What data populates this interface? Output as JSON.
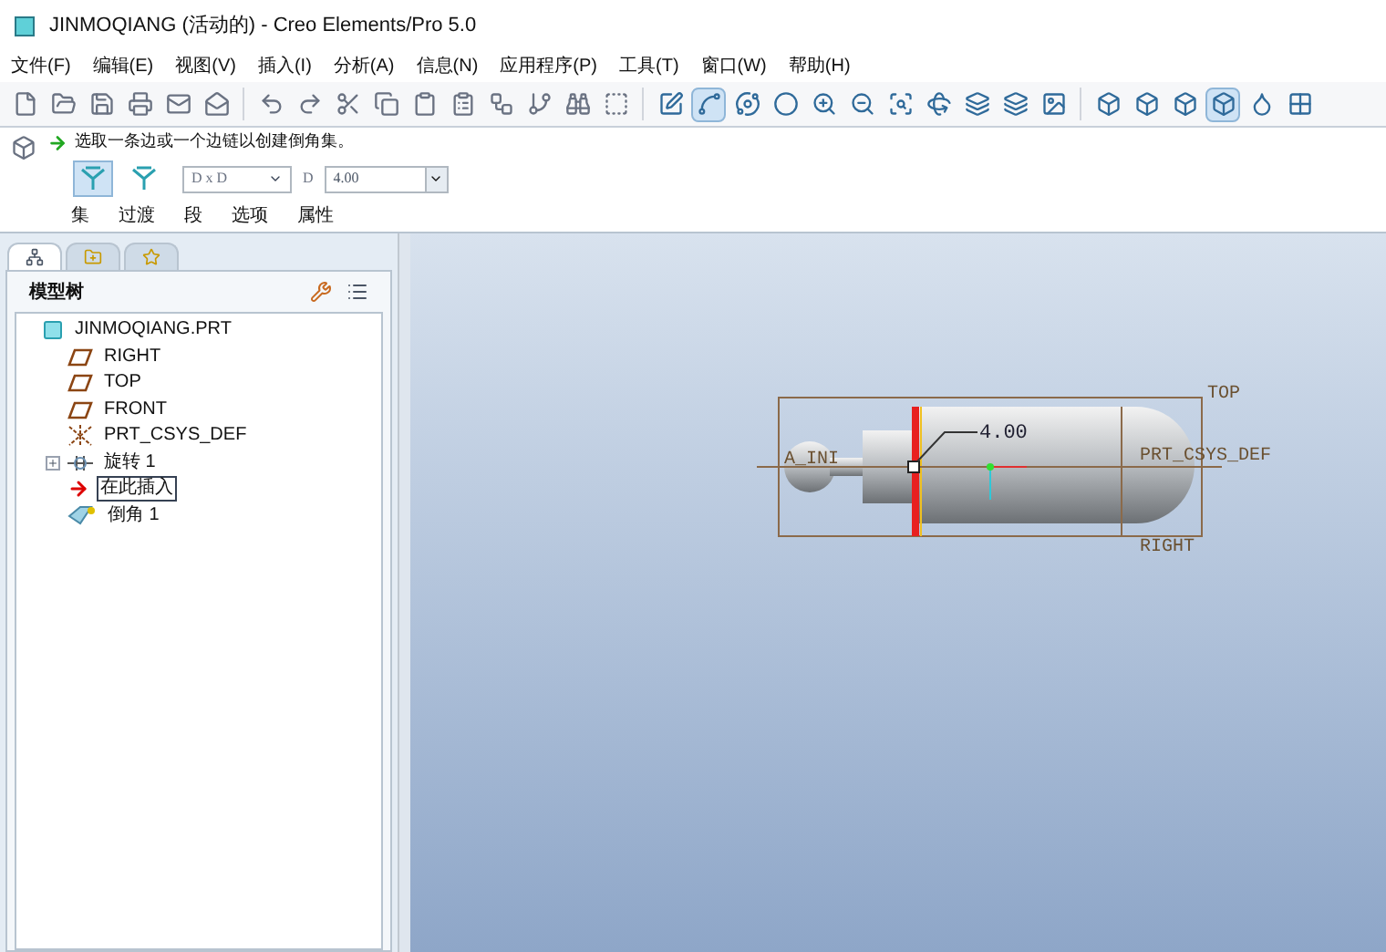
{
  "window": {
    "title": "JINMOQIANG (活动的) - Creo Elements/Pro 5.0"
  },
  "menu": [
    "文件(F)",
    "编辑(E)",
    "视图(V)",
    "插入(I)",
    "分析(A)",
    "信息(N)",
    "应用程序(P)",
    "工具(T)",
    "窗口(W)",
    "帮助(H)"
  ],
  "toolbar": [
    {
      "kind": "new"
    },
    {
      "kind": "open"
    },
    {
      "kind": "save"
    },
    {
      "kind": "print"
    },
    {
      "kind": "mail"
    },
    {
      "kind": "mail2"
    },
    {
      "kind": "sep"
    },
    {
      "kind": "undo"
    },
    {
      "kind": "redo"
    },
    {
      "kind": "cut"
    },
    {
      "kind": "copy"
    },
    {
      "kind": "paste"
    },
    {
      "kind": "paste2"
    },
    {
      "kind": "regen"
    },
    {
      "kind": "regen2"
    },
    {
      "kind": "find"
    },
    {
      "kind": "selbox"
    },
    {
      "kind": "sep"
    },
    {
      "kind": "repaint"
    },
    {
      "kind": "spin",
      "on": true
    },
    {
      "kind": "orient"
    },
    {
      "kind": "shade"
    },
    {
      "kind": "zoomin"
    },
    {
      "kind": "zoomout"
    },
    {
      "kind": "fit"
    },
    {
      "kind": "reorient"
    },
    {
      "kind": "viewmgr"
    },
    {
      "kind": "layers"
    },
    {
      "kind": "appearance"
    },
    {
      "kind": "sep"
    },
    {
      "kind": "wire",
      "selected": false
    },
    {
      "kind": "hidden",
      "selected": false
    },
    {
      "kind": "nohidden",
      "selected": false
    },
    {
      "kind": "shaded",
      "selected": true
    },
    {
      "kind": "enhanced"
    },
    {
      "kind": "datum"
    }
  ],
  "dashboard": {
    "message": "选取一条边或一个边链以创建倒角集。",
    "modes": [
      {
        "selected": true
      },
      {
        "selected": false
      }
    ],
    "scheme": "D x D",
    "dim_label": "D",
    "dim_value": "4.00",
    "tabs": [
      "集",
      "过渡",
      "段",
      "选项",
      "属性"
    ]
  },
  "navigator": {
    "tabs": [
      {
        "kind": "tree",
        "selected": true
      },
      {
        "kind": "folder",
        "selected": false
      },
      {
        "kind": "favorites",
        "selected": false
      }
    ],
    "title": "模型树"
  },
  "model_tree": [
    {
      "label": "JINMOQIANG.PRT",
      "kind": "part",
      "children": [
        {
          "label": "RIGHT",
          "kind": "plane"
        },
        {
          "label": "TOP",
          "kind": "plane"
        },
        {
          "label": "FRONT",
          "kind": "plane"
        },
        {
          "label": "PRT_CSYS_DEF",
          "kind": "csys"
        },
        {
          "label": "旋转 1",
          "kind": "revolve",
          "expanded": false
        },
        {
          "label": "在此插入",
          "kind": "insert",
          "selected": true
        },
        {
          "label": "倒角 1",
          "kind": "chamfer"
        }
      ]
    }
  ],
  "graphics": {
    "dimension": "4.00",
    "labels": [
      "TOP",
      "PRT_CSYS_DEF",
      "A_INI",
      "RIGHT"
    ]
  }
}
